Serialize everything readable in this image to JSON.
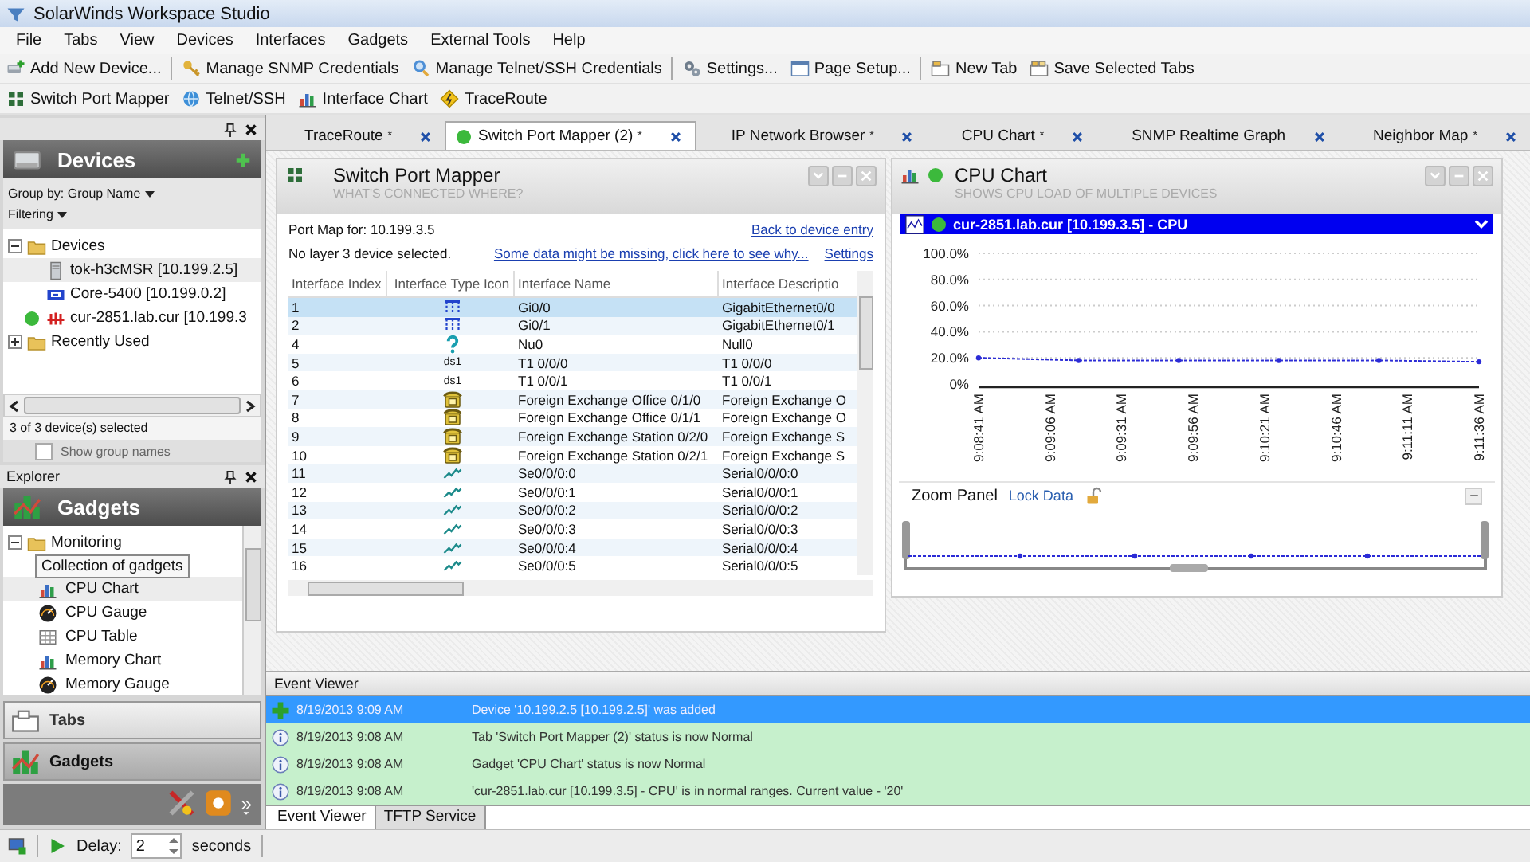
{
  "window": {
    "title": "SolarWinds Workspace Studio"
  },
  "menu": [
    "File",
    "Tabs",
    "View",
    "Devices",
    "Interfaces",
    "Gadgets",
    "External Tools",
    "Help"
  ],
  "toolbar_main": [
    {
      "label": "Add New Device..."
    },
    {
      "label": "Manage SNMP Credentials"
    },
    {
      "label": "Manage Telnet/SSH Credentials"
    },
    {
      "label": "Settings..."
    },
    {
      "label": "Page Setup..."
    },
    {
      "label": "New Tab"
    },
    {
      "label": "Save Selected Tabs"
    }
  ],
  "toolbar_tools": [
    {
      "label": "Switch Port Mapper"
    },
    {
      "label": "Telnet/SSH"
    },
    {
      "label": "Interface Chart"
    },
    {
      "label": "TraceRoute"
    }
  ],
  "devices_pane": {
    "title": "Devices",
    "group_by": "Group by: Group Name",
    "filtering": "Filtering",
    "tree": [
      {
        "label": "Devices",
        "expanded": true,
        "children": [
          {
            "label": "tok-h3cMSR [10.199.2.5]",
            "kind": "server",
            "online": false,
            "selected": true
          },
          {
            "label": "Core-5400 [10.199.0.2]",
            "kind": "switch",
            "online": false,
            "selected": false
          },
          {
            "label": "cur-2851.lab.cur [10.199.3",
            "kind": "router",
            "online": true,
            "selected": false
          }
        ]
      },
      {
        "label": "Recently Used",
        "expanded": false
      }
    ],
    "selection_count": "3 of 3 device(s) selected",
    "show_group_names": {
      "label": "Show group names",
      "checked": false
    }
  },
  "explorer": {
    "title": "Explorer",
    "header": "Gadgets",
    "tooltip": "Collection of gadgets",
    "tree": [
      {
        "label": "Monitoring",
        "expanded": true,
        "children": [
          {
            "label": "CPU Chart",
            "kind": "chart",
            "selected": true
          },
          {
            "label": "CPU Gauge",
            "kind": "gauge",
            "selected": false
          },
          {
            "label": "CPU Table",
            "kind": "table",
            "selected": false
          },
          {
            "label": "Memory Chart",
            "kind": "chart",
            "selected": false
          },
          {
            "label": "Memory Gauge",
            "kind": "gauge",
            "selected": false
          }
        ]
      }
    ]
  },
  "nav_buttons": [
    {
      "label": "Tabs",
      "selected": false
    },
    {
      "label": "Gadgets",
      "selected": true
    }
  ],
  "tabs": [
    {
      "label": "TraceRoute",
      "marker": "*",
      "selected": false
    },
    {
      "label": "Switch Port Mapper (2)",
      "marker": "*",
      "selected": true
    },
    {
      "label": "IP Network Browser",
      "marker": "*",
      "selected": false
    },
    {
      "label": "CPU Chart",
      "marker": "*",
      "selected": false
    },
    {
      "label": "SNMP Realtime Graph",
      "selected": false
    },
    {
      "label": "Neighbor Map",
      "marker": "*",
      "selected": false
    }
  ],
  "port_mapper": {
    "title": "Switch Port Mapper",
    "subtitle": "WHAT'S CONNECTED WHERE?",
    "port_map_for": "Port Map for: 10.199.3.5",
    "back_link": "Back to device entry",
    "no_layer3": "No layer 3 device selected.",
    "missing_link": "Some data might be missing, click here to see why...",
    "settings_link": "Settings",
    "columns": [
      "Interface Index",
      "Interface Type Icon",
      "Interface Name",
      "Interface Descriptio"
    ],
    "rows": [
      {
        "index": "1",
        "kind": "ethernet",
        "name": "Gi0/0",
        "description": "GigabitEthernet0/0",
        "selected": true
      },
      {
        "index": "2",
        "kind": "ethernet",
        "name": "Gi0/1",
        "description": "GigabitEthernet0/1",
        "selected": false
      },
      {
        "index": "4",
        "kind": "question",
        "name": "Nu0",
        "description": "Null0",
        "selected": false
      },
      {
        "index": "5",
        "kind": "ds1",
        "type_text": "ds1",
        "name": "T1 0/0/0",
        "description": "T1 0/0/0",
        "selected": false
      },
      {
        "index": "6",
        "kind": "ds1",
        "type_text": "ds1",
        "name": "T1 0/0/1",
        "description": "T1 0/0/1",
        "selected": false
      },
      {
        "index": "7",
        "kind": "phone",
        "name": "Foreign Exchange Office 0/1/0",
        "description": "Foreign Exchange O",
        "selected": false
      },
      {
        "index": "8",
        "kind": "phone",
        "name": "Foreign Exchange Office 0/1/1",
        "description": "Foreign Exchange O",
        "selected": false
      },
      {
        "index": "9",
        "kind": "phone",
        "name": "Foreign Exchange Station 0/2/0",
        "description": "Foreign Exchange S",
        "selected": false
      },
      {
        "index": "10",
        "kind": "phone",
        "name": "Foreign Exchange Station 0/2/1",
        "description": "Foreign Exchange S",
        "selected": false
      },
      {
        "index": "11",
        "kind": "serial",
        "name": "Se0/0/0:0",
        "description": "Serial0/0/0:0",
        "selected": false
      },
      {
        "index": "12",
        "kind": "serial",
        "name": "Se0/0/0:1",
        "description": "Serial0/0/0:1",
        "selected": false
      },
      {
        "index": "13",
        "kind": "serial",
        "name": "Se0/0/0:2",
        "description": "Serial0/0/0:2",
        "selected": false
      },
      {
        "index": "14",
        "kind": "serial",
        "name": "Se0/0/0:3",
        "description": "Serial0/0/0:3",
        "selected": false
      },
      {
        "index": "15",
        "kind": "serial",
        "name": "Se0/0/0:4",
        "description": "Serial0/0/0:4",
        "selected": false
      },
      {
        "index": "16",
        "kind": "serial",
        "name": "Se0/0/0:5",
        "description": "Serial0/0/0:5",
        "selected": false
      }
    ]
  },
  "cpu_chart": {
    "title": "CPU Chart",
    "subtitle": "SHOWS CPU LOAD OF MULTIPLE DEVICES",
    "zoom_panel": "Zoom Panel",
    "lock_link": "Lock Data",
    "chart_data": {
      "type": "line",
      "categories": [
        "9:08:41 AM",
        null,
        null,
        null,
        null,
        "9:09:06 AM",
        null,
        null,
        null,
        null,
        "9:09:31 AM",
        null,
        null,
        null,
        null,
        "9:09:56 AM",
        null,
        null,
        null,
        null,
        "9:10:21 AM",
        null,
        null,
        null,
        null,
        "9:10:46 AM",
        null,
        null,
        null,
        null,
        "9:11:11 AM",
        null,
        null,
        null,
        null,
        "9:11:36 AM"
      ],
      "grid": true,
      "series": [
        {
          "name": "cur-2851.lab.cur [10.199.3.5] - CPU",
          "color": "#2b2bd6",
          "line_style": "dashed",
          "marker": "circle",
          "values": [
            20,
            null,
            null,
            null,
            null,
            null,
            null,
            18,
            null,
            null,
            null,
            null,
            null,
            null,
            18,
            null,
            null,
            null,
            null,
            null,
            null,
            18,
            null,
            null,
            null,
            null,
            null,
            null,
            18,
            null,
            null,
            null,
            null,
            null,
            null,
            17
          ]
        }
      ],
      "ylim": [
        0,
        100
      ],
      "yticks": [
        {
          "value": 0,
          "label": "0%"
        },
        {
          "value": 20,
          "label": "20.0%"
        },
        {
          "value": 40,
          "label": "40.0%"
        },
        {
          "value": 60,
          "label": "60.0%"
        },
        {
          "value": 80,
          "label": "80.0%"
        },
        {
          "value": 100,
          "label": "100.0%"
        }
      ]
    }
  },
  "event_viewer": {
    "title": "Event Viewer",
    "events": [
      {
        "kind": "add",
        "time": "8/19/2013 9:09 AM",
        "message": "Device '10.199.2.5 [10.199.2.5]' was added",
        "selected": true
      },
      {
        "kind": "info",
        "time": "8/19/2013 9:08 AM",
        "message": "Tab 'Switch Port Mapper (2)' status is now Normal",
        "selected": false
      },
      {
        "kind": "info",
        "time": "8/19/2013 9:08 AM",
        "message": "Gadget 'CPU Chart' status is now Normal",
        "selected": false
      },
      {
        "kind": "info",
        "time": "8/19/2013 9:08 AM",
        "message": "'cur-2851.lab.cur [10.199.3.5] - CPU' is in normal ranges. Current value - '20'",
        "selected": false
      }
    ],
    "tabs": [
      {
        "label": "Event Viewer",
        "selected": true
      },
      {
        "label": "TFTP Service",
        "selected": false
      }
    ]
  },
  "status_bar": {
    "delay_label": "Delay:",
    "delay_value": "2",
    "unit": "seconds"
  }
}
